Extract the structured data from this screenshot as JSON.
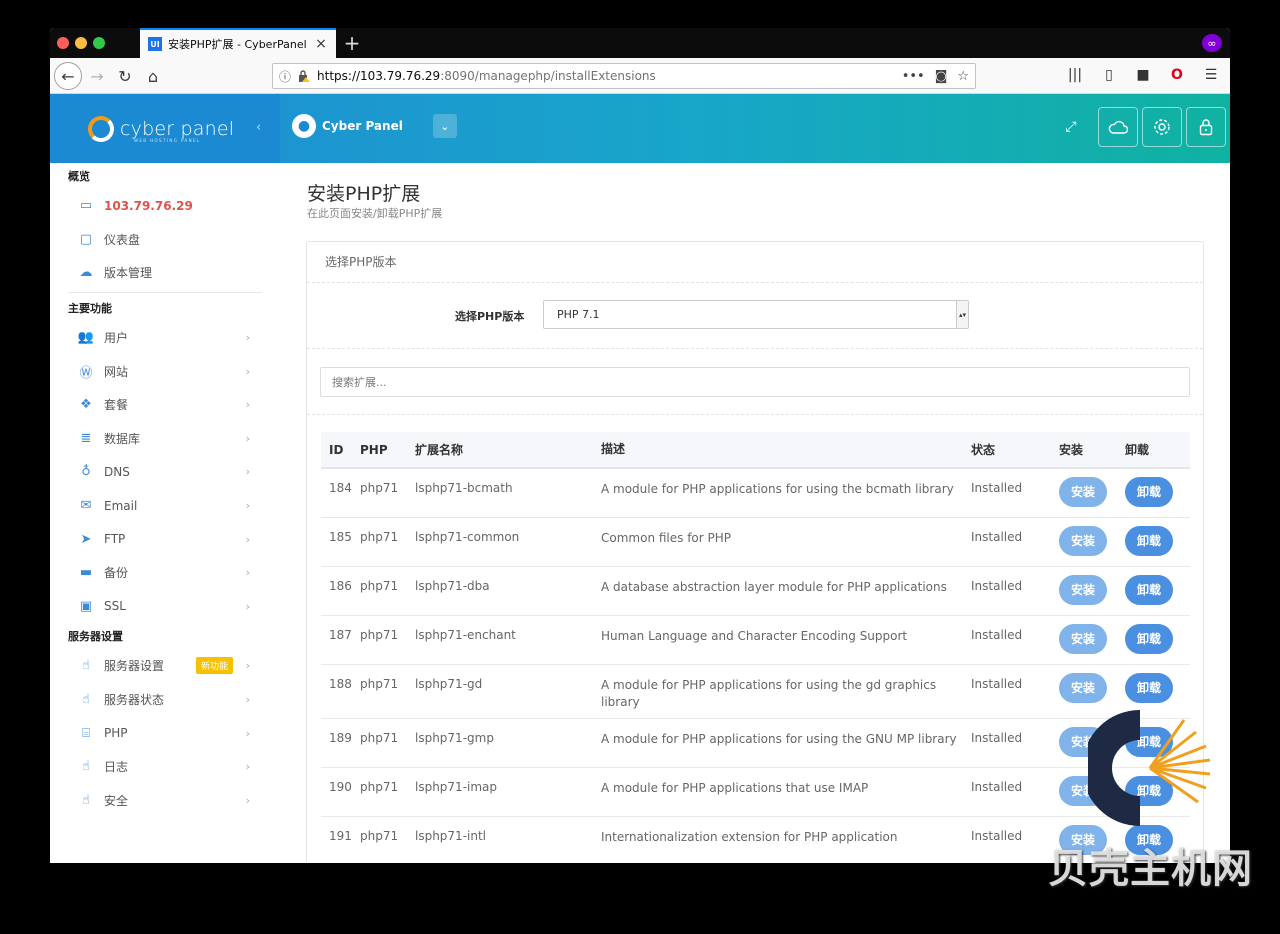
{
  "browser": {
    "tab_title": "安装PHP扩展 - CyberPanel",
    "tab_favicon": "UI",
    "url_host": "https://103.79.76.29",
    "url_rest": ":8090/managephp/installExtensions",
    "new_tab": "+",
    "close": "×"
  },
  "header": {
    "logo_text": "cyber panel",
    "logo_sub": "WEB HOSTING PANEL",
    "user_name": "Cyber Panel"
  },
  "sidebar": {
    "overview_title": "概览",
    "overview_items": [
      {
        "label": "103.79.76.29"
      },
      {
        "label": "仪表盘"
      },
      {
        "label": "版本管理"
      }
    ],
    "main_title": "主要功能",
    "main_items": [
      {
        "label": "用户"
      },
      {
        "label": "网站"
      },
      {
        "label": "套餐"
      },
      {
        "label": "数据库"
      },
      {
        "label": "DNS"
      },
      {
        "label": "Email"
      },
      {
        "label": "FTP"
      },
      {
        "label": "备份"
      },
      {
        "label": "SSL"
      }
    ],
    "server_title": "服务器设置",
    "server_items": [
      {
        "label": "服务器设置",
        "badge": "新功能"
      },
      {
        "label": "服务器状态"
      },
      {
        "label": "PHP"
      },
      {
        "label": "日志"
      },
      {
        "label": "安全"
      }
    ]
  },
  "page": {
    "title": "安装PHP扩展",
    "subtitle": "在此页面安装/卸载PHP扩展",
    "panel_title": "选择PHP版本",
    "version_label": "选择PHP版本",
    "version_value": "PHP 7.1",
    "search_placeholder": "搜索扩展..."
  },
  "table": {
    "headers": {
      "id": "ID",
      "php": "PHP",
      "name": "扩展名称",
      "desc": "描述",
      "status": "状态",
      "install": "安装",
      "uninstall": "卸载"
    },
    "install_label": "安装",
    "uninstall_label": "卸载",
    "rows": [
      {
        "id": "184",
        "php": "php71",
        "name": "lsphp71-bcmath",
        "desc": "A module for PHP applications for using the bcmath library",
        "status": "Installed"
      },
      {
        "id": "185",
        "php": "php71",
        "name": "lsphp71-common",
        "desc": "Common files for PHP",
        "status": "Installed"
      },
      {
        "id": "186",
        "php": "php71",
        "name": "lsphp71-dba",
        "desc": "A database abstraction layer module for PHP applications",
        "status": "Installed"
      },
      {
        "id": "187",
        "php": "php71",
        "name": "lsphp71-enchant",
        "desc": "Human Language and Character Encoding Support",
        "status": "Installed"
      },
      {
        "id": "188",
        "php": "php71",
        "name": "lsphp71-gd",
        "desc": "A module for PHP applications for using the gd graphics library",
        "status": "Installed"
      },
      {
        "id": "189",
        "php": "php71",
        "name": "lsphp71-gmp",
        "desc": "A module for PHP applications for using the GNU MP library",
        "status": "Installed"
      },
      {
        "id": "190",
        "php": "php71",
        "name": "lsphp71-imap",
        "desc": "A module for PHP applications that use IMAP",
        "status": "Installed"
      },
      {
        "id": "191",
        "php": "php71",
        "name": "lsphp71-intl",
        "desc": "Internationalization extension for PHP application",
        "status": "Installed"
      }
    ]
  },
  "watermark": {
    "text": "贝壳主机网"
  },
  "colors": {
    "header_start": "#1f8bd4",
    "header_end": "#10b2a1",
    "active_item": "#e0524b",
    "install_btn": "#7fb3ea",
    "uninstall_btn": "#4a8fe0",
    "badge": "#f8c100"
  }
}
